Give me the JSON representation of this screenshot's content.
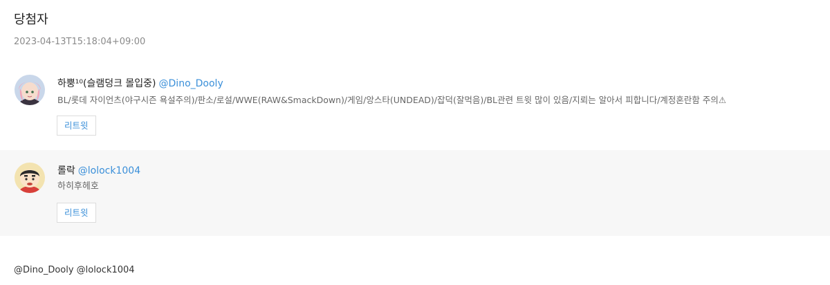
{
  "page": {
    "title": "당첨자",
    "timestamp": "2023-04-13T15:18:04+09:00"
  },
  "winners": [
    {
      "display_name": "하뿡¹⁰(슬램덩크 몰입중)",
      "handle": "@Dino_Dooly",
      "bio": "BL/롯데 자이언츠(야구시즌 욕설주의)/판소/로설/WWE(RAW&SmackDown)/게임/앙스타(UNDEAD)/잡덕(잘먹음)/BL관련 트윗 많이 있음/지뢰는 알아서 피합니다/계정혼란함 주의⚠",
      "retweet_label": "리트윗"
    },
    {
      "display_name": "롤락",
      "handle": "@lolock1004",
      "bio": "하히후헤호",
      "retweet_label": "리트윗"
    }
  ],
  "mentions": "@Dino_Dooly @lolock1004",
  "colors": {
    "link": "#3a8fd9",
    "alt_row_bg": "#f7f7f7"
  }
}
